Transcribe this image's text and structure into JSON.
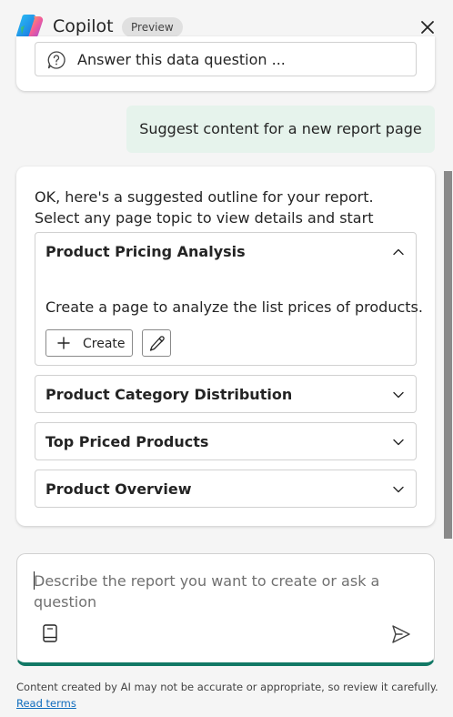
{
  "header": {
    "title": "Copilot",
    "badge": "Preview"
  },
  "suggestion": {
    "text": "Answer this data question ..."
  },
  "user_message": "Suggest content for a new report page",
  "response": {
    "intro": "OK, here's a suggested outline for your report. Select any page topic to view details and start creating pages.",
    "topics": [
      {
        "title": "Product Pricing Analysis",
        "expanded": true,
        "description": "Create a page to analyze the list prices of products.",
        "create_label": "Create"
      },
      {
        "title": "Product Category Distribution",
        "expanded": false
      },
      {
        "title": "Top Priced Products",
        "expanded": false
      },
      {
        "title": "Product Overview",
        "expanded": false
      }
    ]
  },
  "input": {
    "placeholder": "Describe the report you want to create or ask a question",
    "value": ""
  },
  "footer": {
    "disclaimer": "Content created by AI may not be accurate or appropriate, so review it carefully.",
    "read_terms": "Read terms"
  },
  "colors": {
    "background": "#f5f5f5",
    "user_bubble": "#e6f3ec",
    "accent": "#117865",
    "link": "#0f6cbd"
  }
}
